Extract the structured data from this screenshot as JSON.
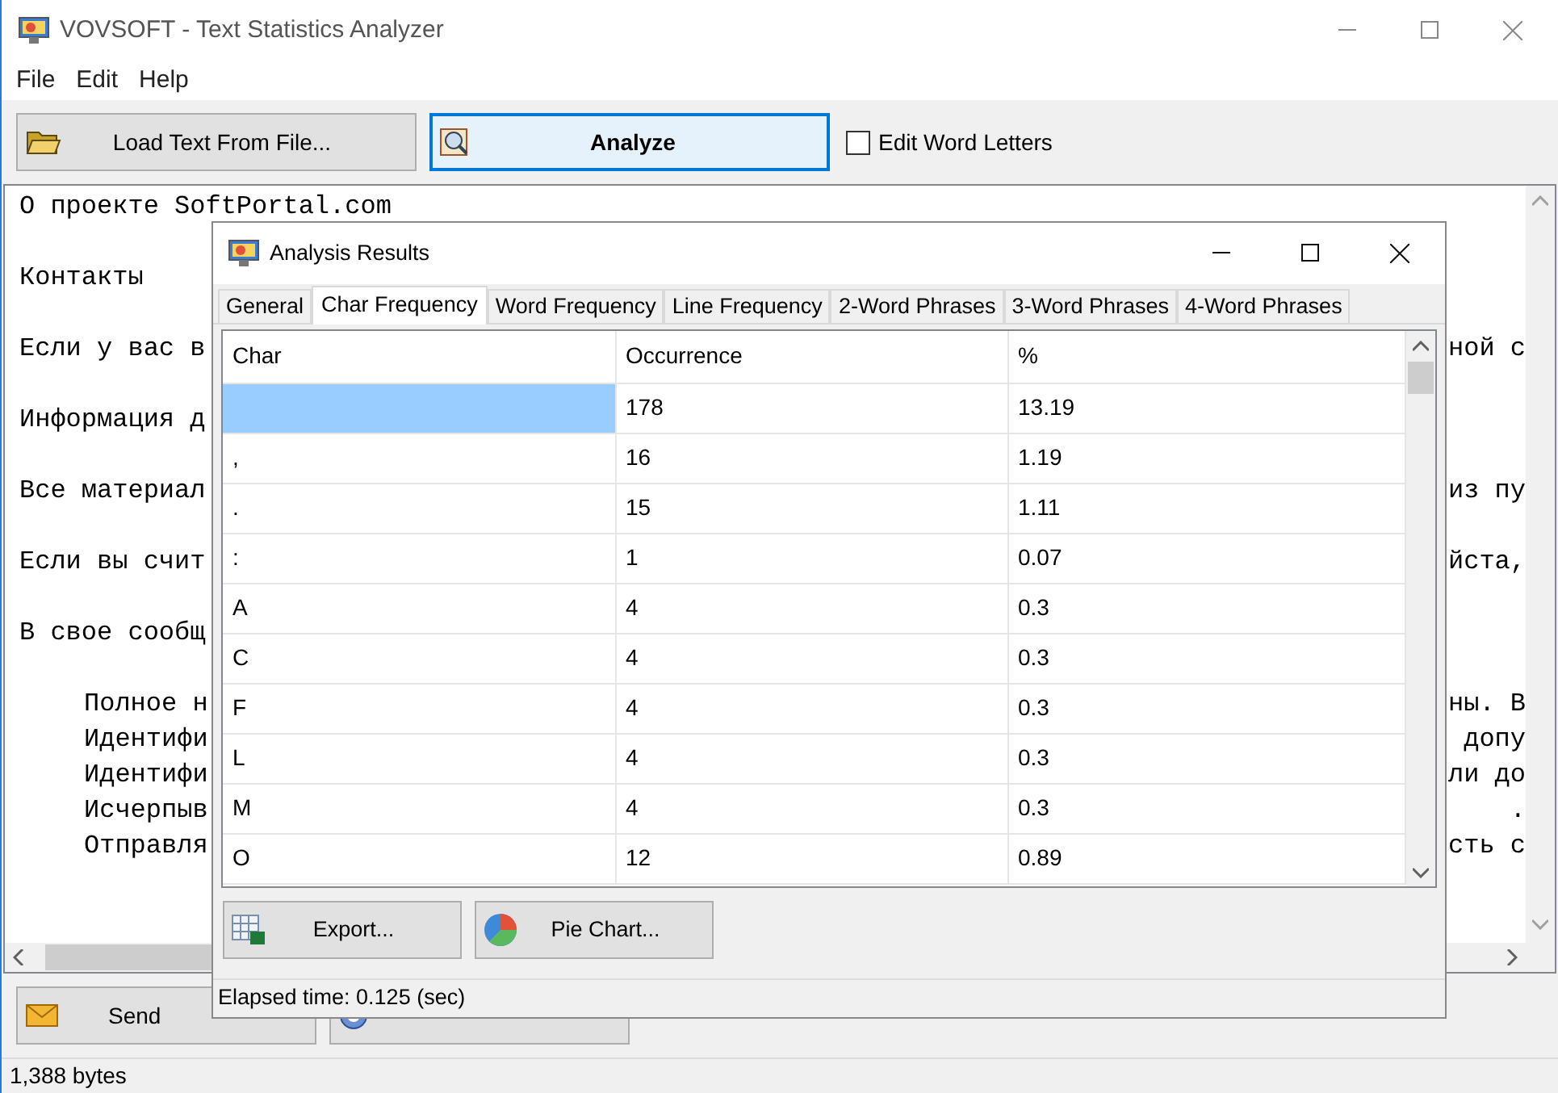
{
  "window": {
    "title": "VOVSOFT - Text Statistics Analyzer"
  },
  "menu": [
    "File",
    "Edit",
    "Help"
  ],
  "toolbar": {
    "load_button": "Load Text From File...",
    "analyze_button": "Analyze",
    "edit_word_letters": {
      "label": "Edit Word Letters",
      "checked": false
    }
  },
  "editor_paragraphs": [
    [
      {
        "left": "О проекте SoftPortal.com",
        "indent": false
      }
    ],
    [
      {
        "left": "Контакты",
        "indent": false
      }
    ],
    [
      {
        "left": "Если у вас в",
        "right": "ной с",
        "indent": false
      }
    ],
    [
      {
        "left": "Информация д",
        "indent": false
      }
    ],
    [
      {
        "left": "Все материал",
        "right": "из пу",
        "indent": false
      }
    ],
    [
      {
        "left": "Если вы счит",
        "right": "йста,",
        "indent": false
      }
    ],
    [
      {
        "left": "В свое сообщ",
        "indent": false
      }
    ],
    [
      {
        "left": "Полное н",
        "right": "ны. В",
        "indent": true
      },
      {
        "left": "Идентифи",
        "right": "допу",
        "indent": true
      },
      {
        "left": "Идентифи",
        "right": "ли до",
        "indent": true
      },
      {
        "left": "Исчерпыв",
        "right": ".",
        "indent": true
      },
      {
        "left": "Отправля",
        "right": "сть с",
        "indent": true
      }
    ]
  ],
  "feedback_button": "Send",
  "status_bar": "1,388 bytes",
  "dialog": {
    "title": "Analysis Results",
    "tabs": [
      {
        "label": "General",
        "selected": false
      },
      {
        "label": "Char Frequency",
        "selected": true
      },
      {
        "label": "Word Frequency",
        "selected": false
      },
      {
        "label": "Line Frequency",
        "selected": false
      },
      {
        "label": "2-Word Phrases",
        "selected": false
      },
      {
        "label": "3-Word Phrases",
        "selected": false
      },
      {
        "label": "4-Word Phrases",
        "selected": false
      }
    ],
    "table": {
      "columns": [
        "Char",
        "Occurrence",
        "%"
      ],
      "rows": [
        {
          "cells": [
            "",
            "178",
            "13.19"
          ],
          "selected": true
        },
        {
          "cells": [
            ",",
            "16",
            "1.19"
          ],
          "selected": false
        },
        {
          "cells": [
            ".",
            "15",
            "1.11"
          ],
          "selected": false
        },
        {
          "cells": [
            ":",
            "1",
            "0.07"
          ],
          "selected": false
        },
        {
          "cells": [
            "A",
            "4",
            "0.3"
          ],
          "selected": false
        },
        {
          "cells": [
            "C",
            "4",
            "0.3"
          ],
          "selected": false
        },
        {
          "cells": [
            "F",
            "4",
            "0.3"
          ],
          "selected": false
        },
        {
          "cells": [
            "L",
            "4",
            "0.3"
          ],
          "selected": false
        },
        {
          "cells": [
            "M",
            "4",
            "0.3"
          ],
          "selected": false
        },
        {
          "cells": [
            "O",
            "12",
            "0.89"
          ],
          "selected": false
        }
      ]
    },
    "buttons": [
      "Export...",
      "Pie Chart..."
    ],
    "status": "Elapsed time: 0.125 (sec)"
  }
}
